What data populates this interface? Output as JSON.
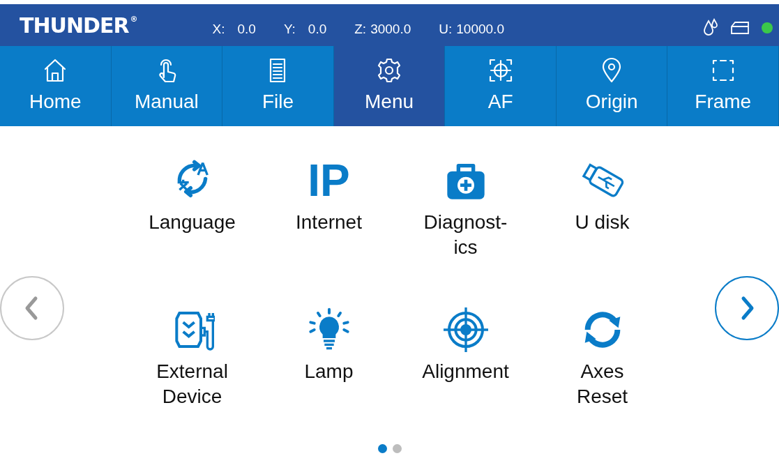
{
  "header": {
    "logo": "THUNDER",
    "logo_mark": "®",
    "coordinates": [
      {
        "label": "X:",
        "value": "0.0"
      },
      {
        "label": "Y:",
        "value": "0.0"
      },
      {
        "label": "Z:",
        "value": "3000.0"
      },
      {
        "label": "U:",
        "value": "10000.0"
      }
    ]
  },
  "tabs": [
    {
      "label": "Home",
      "kind": "home",
      "selected": false
    },
    {
      "label": "Manual",
      "kind": "manual",
      "selected": false
    },
    {
      "label": "File",
      "kind": "file",
      "selected": false
    },
    {
      "label": "Menu",
      "kind": "menu",
      "selected": true
    },
    {
      "label": "AF",
      "kind": "af",
      "selected": false
    },
    {
      "label": "Origin",
      "kind": "origin",
      "selected": false
    },
    {
      "label": "Frame",
      "kind": "frame",
      "selected": false
    }
  ],
  "menu_items": [
    {
      "label": "Language",
      "kind": "language"
    },
    {
      "label": "Internet",
      "kind": "ip",
      "icon_text": "IP"
    },
    {
      "label": "Diagnost-\nics",
      "kind": "diagnostics"
    },
    {
      "label": "U disk",
      "kind": "udisk"
    },
    {
      "label": "External\nDevice",
      "kind": "external"
    },
    {
      "label": "Lamp",
      "kind": "lamp"
    },
    {
      "label": "Alignment",
      "kind": "alignment"
    },
    {
      "label": "Axes\nReset",
      "kind": "reset"
    }
  ],
  "pages": [
    {
      "selected": true
    },
    {
      "selected": false
    }
  ]
}
